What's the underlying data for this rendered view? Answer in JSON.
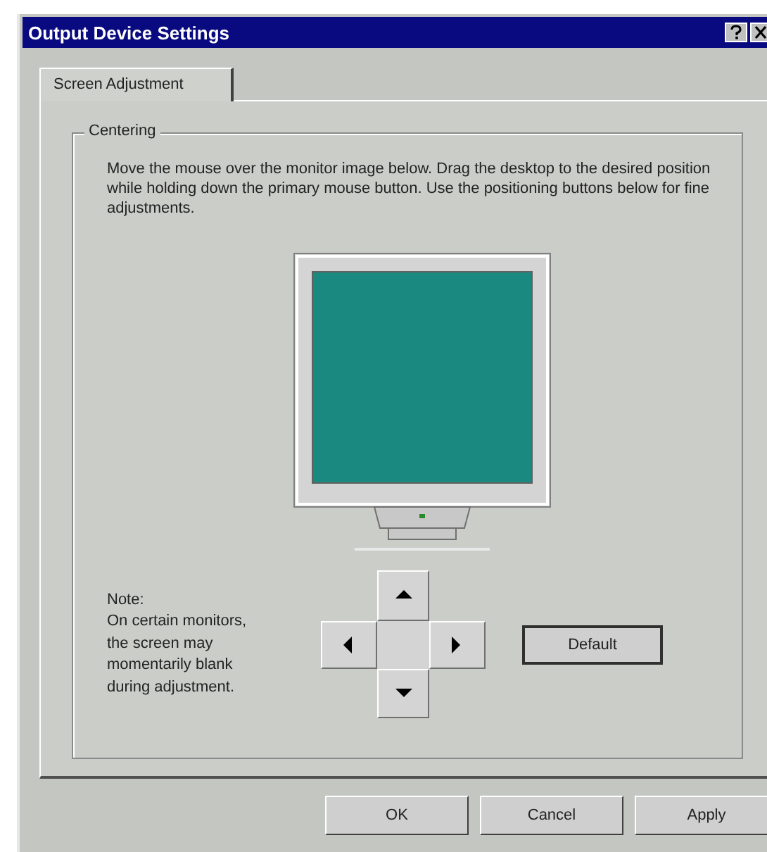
{
  "window": {
    "title": "Output Device Settings"
  },
  "tabs": [
    {
      "label": "Screen Adjustment",
      "selected": true
    }
  ],
  "group": {
    "title": "Centering",
    "instructions": "Move the mouse over the monitor image below. Drag the desktop to the desired position while holding down the primary mouse button. Use the positioning buttons below for fine adjustments.",
    "note_lines": [
      "Note:",
      "On certain monitors,",
      "the screen may",
      "momentarily blank",
      "during adjustment."
    ],
    "arrows": [
      {
        "kind": "up"
      },
      {
        "kind": "left"
      },
      {
        "kind": "right"
      },
      {
        "kind": "down"
      }
    ],
    "default_button": "Default"
  },
  "buttons": [
    "OK",
    "Cancel",
    "Apply"
  ]
}
